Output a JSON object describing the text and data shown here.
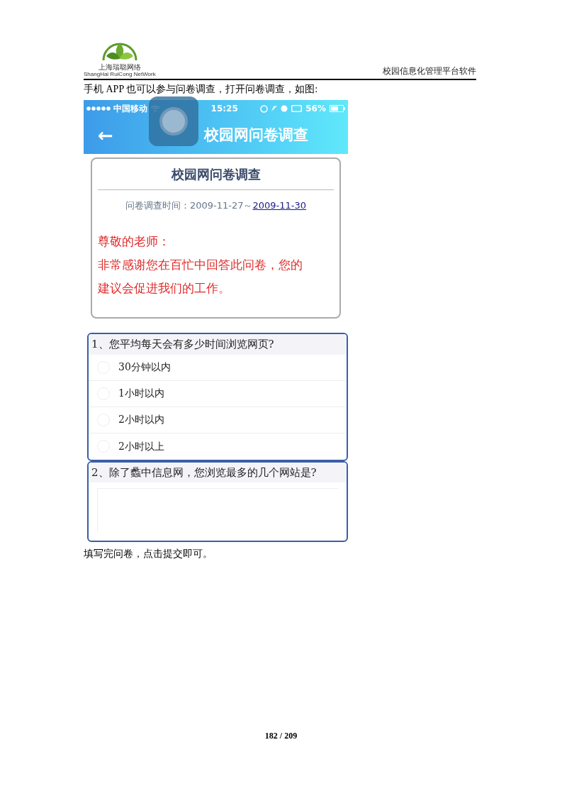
{
  "header": {
    "logo_cn": "上海瑞聪网络",
    "logo_en": "ShangHai RuiCong NetWork",
    "doc_title": "校园信息化管理平台软件"
  },
  "intro": "手机 APP 也可以参与问卷调查，打开问卷调查，如图:",
  "phone": {
    "status_bar": {
      "carrier": "中国移动",
      "time": "15:25",
      "battery": "56%"
    },
    "app_bar": {
      "back": "←",
      "title": "校园网问卷调查"
    },
    "card": {
      "title": "校园网问卷调查",
      "time_label": "问卷调查时间：2009-11-27～",
      "time_end": "2009-11-30",
      "greeting": "尊敬的老师：",
      "message": "非常感谢您在百忙中回答此问卷，您的建议会促进我们的工作。"
    },
    "questions": [
      {
        "kind": "choice",
        "text": "1、您平均每天会有多少时间浏览网页?",
        "options": [
          {
            "label": "30分钟以内",
            "selected": false
          },
          {
            "label": "1小时以内",
            "selected": false
          },
          {
            "label": "2小时以内",
            "selected": false
          },
          {
            "label": "2小时以上",
            "selected": false
          }
        ]
      },
      {
        "kind": "text",
        "text": "2、除了蠡中信息网，您浏览最多的几个网站是?"
      }
    ]
  },
  "outro": "填写完问卷，点击提交即可。",
  "page_number": "182 / 209"
}
